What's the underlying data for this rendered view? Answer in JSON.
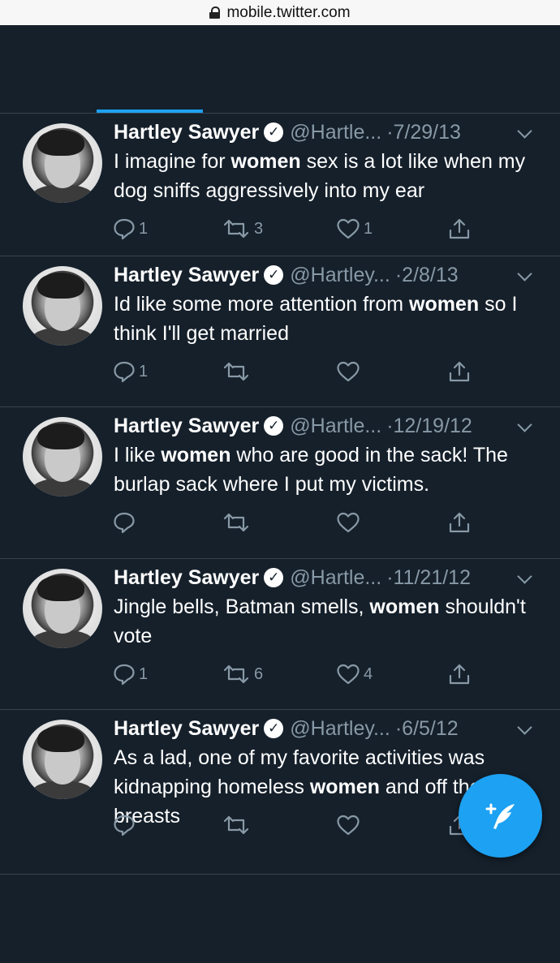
{
  "browser": {
    "url": "mobile.twitter.com"
  },
  "tweets": [
    {
      "name": "Hartley Sawyer",
      "handle": "@Hartle...",
      "date": "·7/29/13",
      "text_parts": [
        {
          "t": "I imagine for ",
          "b": false
        },
        {
          "t": "women",
          "b": true
        },
        {
          "t": " sex is a lot like when my dog sniffs aggressively into my ear",
          "b": false
        }
      ],
      "reply_count": "1",
      "retweet_count": "3",
      "like_count": "1"
    },
    {
      "name": "Hartley Sawyer",
      "handle": "@Hartley...",
      "date": "·2/8/13",
      "text_parts": [
        {
          "t": "Id like some more attention from ",
          "b": false
        },
        {
          "t": "women",
          "b": true
        },
        {
          "t": " so I think I'll get married",
          "b": false
        }
      ],
      "reply_count": "1",
      "retweet_count": "",
      "like_count": ""
    },
    {
      "name": "Hartley Sawyer",
      "handle": "@Hartle...",
      "date": "·12/19/12",
      "text_parts": [
        {
          "t": "I like ",
          "b": false
        },
        {
          "t": "women",
          "b": true
        },
        {
          "t": " who are good in the sack! The burlap sack where I put my victims.",
          "b": false
        }
      ],
      "reply_count": "",
      "retweet_count": "",
      "like_count": ""
    },
    {
      "name": "Hartley Sawyer",
      "handle": "@Hartle...",
      "date": "·11/21/12",
      "text_parts": [
        {
          "t": "Jingle bells, Batman smells, ",
          "b": false
        },
        {
          "t": "women",
          "b": true
        },
        {
          "t": " shouldn't vote",
          "b": false
        }
      ],
      "reply_count": "1",
      "retweet_count": "6",
      "like_count": "4"
    },
    {
      "name": "Hartley Sawyer",
      "handle": "@Hartley...",
      "date": "·6/5/12",
      "text_parts": [
        {
          "t": "As a lad, one of my favorite activities was kidnapping homeless ",
          "b": false
        },
        {
          "t": "women",
          "b": true
        },
        {
          "t": " and",
          "b": false
        },
        {
          "t": " off their breasts",
          "b": false
        }
      ],
      "reply_count": "",
      "retweet_count": "",
      "like_count": ""
    }
  ],
  "icons": {
    "verified": "verified-check-icon",
    "reply": "reply-bubble-icon",
    "retweet": "retweet-arrows-icon",
    "like": "heart-icon",
    "share": "share-upload-icon",
    "more": "chevron-down-icon",
    "compose": "compose-feather-icon"
  },
  "colors": {
    "background": "#15202b",
    "divider": "#38444d",
    "secondary_text": "#8899a6",
    "accent": "#1da1f2"
  }
}
